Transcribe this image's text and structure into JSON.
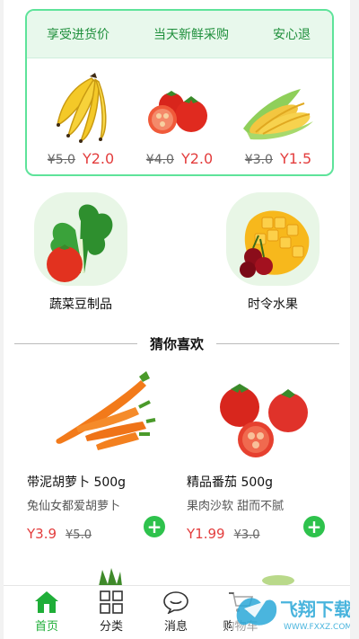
{
  "promo": {
    "banner": [
      "享受进货价",
      "当天新鲜采购",
      "安心退"
    ],
    "items": [
      {
        "icon": "banana-icon",
        "old_price": "¥5.0",
        "new_price": "Y2.0"
      },
      {
        "icon": "tomato-icon",
        "old_price": "¥4.0",
        "new_price": "Y2.0"
      },
      {
        "icon": "corn-icon",
        "old_price": "¥3.0",
        "new_price": "Y1.5"
      }
    ]
  },
  "categories": [
    {
      "label": "蔬菜豆制品",
      "icon": "vegetables-icon"
    },
    {
      "label": "时令水果",
      "icon": "fruit-icon"
    }
  ],
  "section_title": "猜你喜欢",
  "products": [
    {
      "title": "带泥胡萝卜  500g",
      "subtitle": "兔仙女都爱胡萝卜",
      "price": "Y3.9",
      "old_price": "¥5.0",
      "icon": "carrot-icon"
    },
    {
      "title": "精品番茄  500g",
      "subtitle": "果肉沙软 甜而不腻",
      "price": "Y1.99",
      "old_price": "¥3.0",
      "icon": "tomato-icon"
    }
  ],
  "tabbar": [
    {
      "label": "首页",
      "icon": "home-icon",
      "active": true
    },
    {
      "label": "分类",
      "icon": "grid-icon",
      "active": false
    },
    {
      "label": "消息",
      "icon": "message-icon",
      "active": false
    },
    {
      "label": "购物车",
      "icon": "cart-icon",
      "active": false
    }
  ],
  "watermark": {
    "text": "飞翔下载",
    "url": "WWW.FXXZ.COM"
  },
  "colors": {
    "accent": "#2ec24c",
    "price": "#e33d3d",
    "promo_border": "#5ee39a",
    "promo_head": "#e8f8ec"
  }
}
